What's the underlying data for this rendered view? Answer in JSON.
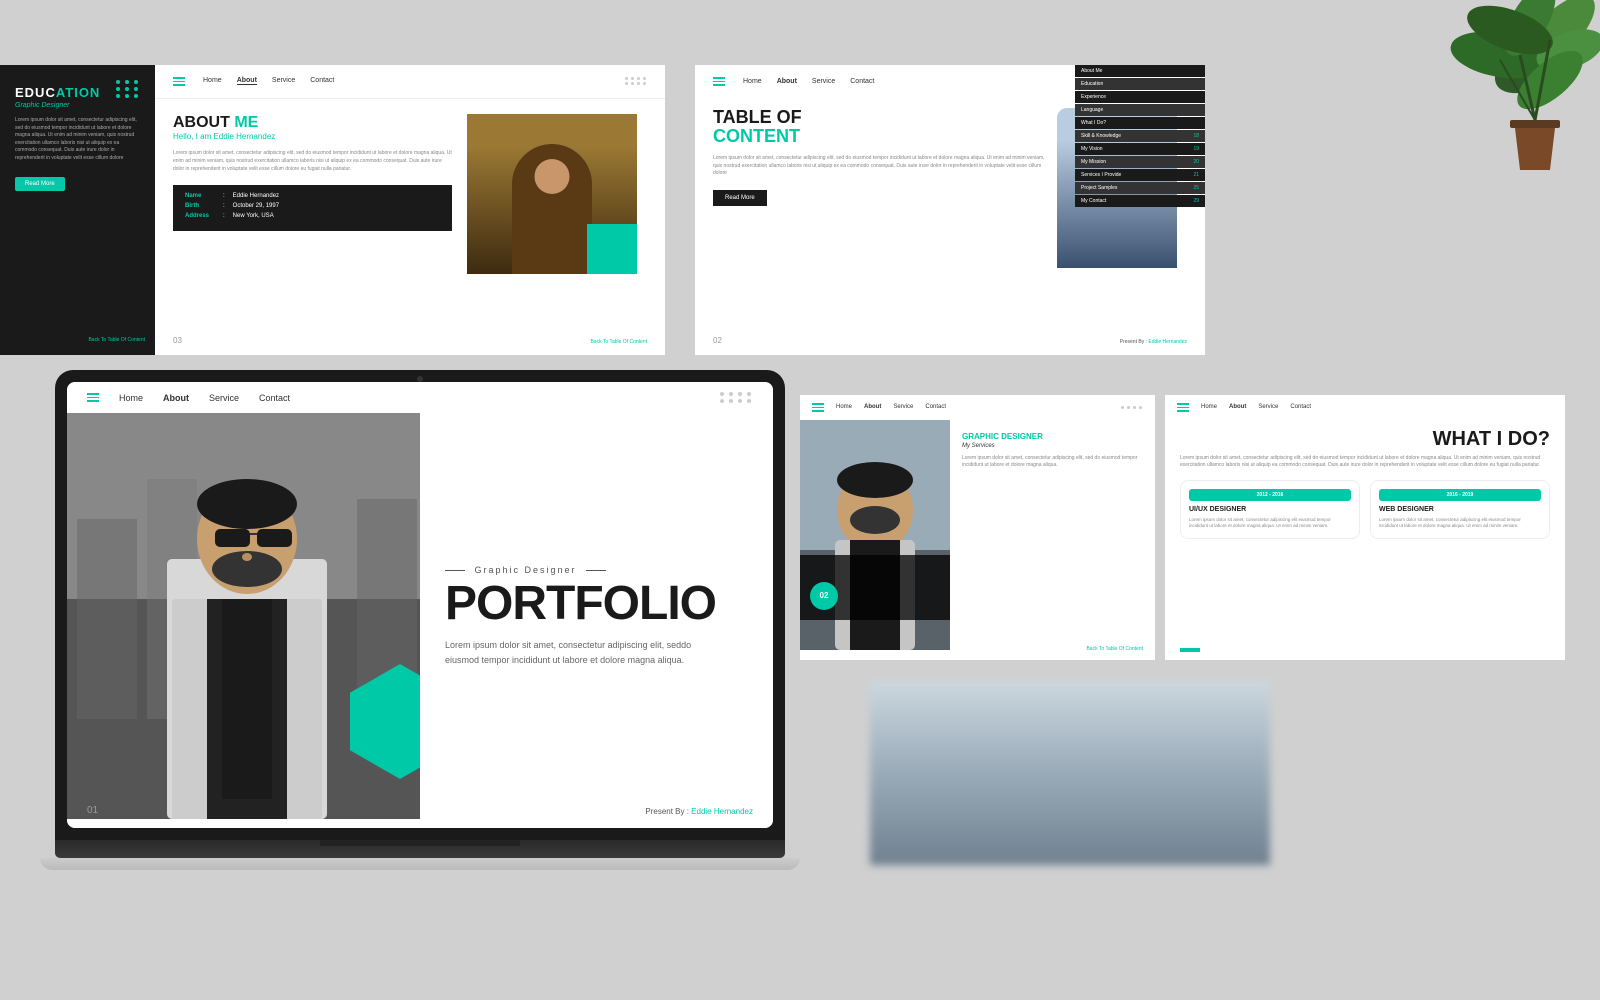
{
  "page": {
    "background": "#d0d0d0"
  },
  "slide_education": {
    "title_prefix": "EDUC",
    "title_suffix": "ATION",
    "subtitle": "Graphic Designer",
    "body": "Lorem ipsum dolor sit amet, consectetur adipiscing elit, sed do eiusmod tempor incididunt ut labore et dolore magna aliqua. Ut enim ad minim veniam, quis nostrud exercitation ullamco laboris nisi ut aliquip ex ea commodo consequat. Duis aute irure dolor in reprehenderit in voluptate velit esse cillum dolore",
    "read_more": "Read More",
    "back_link": "Back To Table Of Content"
  },
  "slide_about": {
    "nav": {
      "links": [
        "Home",
        "About",
        "Service",
        "Contact"
      ],
      "active": "About"
    },
    "title": "ABOUT ME",
    "greeting": "Hello, I am Eddie Hernandez",
    "lorem": "Lorem ipsum dolor sit amet, consectetur adipiscing elit, sed do eiusmod tempor incididunt ut labore et dolore magna aliqua. Ut enim ad minim veniam, quis nostrud exercitation ullamco laboris nisi ut aliquip ex ea commodo consequat. Duis aute irure dolor in reprehenderit in voluptate velit esse cillum dolore eu fugiat nulla pariatur.",
    "info": {
      "name_label": "Name",
      "name_value": "Eddie Hernandez",
      "birth_label": "Birth",
      "birth_value": "October 29, 1997",
      "address_label": "Address",
      "address_value": "New York, USA"
    },
    "page_num": "03",
    "back_link": "Back To Table Of Content"
  },
  "slide_toc": {
    "nav": {
      "links": [
        "Home",
        "About",
        "Service",
        "Contact"
      ],
      "active": "About"
    },
    "title_line1": "TABLE OF",
    "title_line2": "CONTENT",
    "lorem": "Lorem ipsum dolor sit amet, consectetur adipiscing elit, sed do eiusmod tempor incididunt ut labore et dolore magna aliqua. Ut enim ad minim veniam, quis nostrud exercitation ullamco laboris nisi ut aliquip ex ea commodo consequat. Duis aute irure dolor in reprehenderit in voluptate velit esse cillum dolore",
    "read_btn": "Read More",
    "toc_items": [
      {
        "label": "About Me",
        "num": ""
      },
      {
        "label": "Education",
        "num": ""
      },
      {
        "label": "Experience",
        "num": ""
      },
      {
        "label": "Language",
        "num": ""
      },
      {
        "label": "What I Do?",
        "num": ""
      },
      {
        "label": "Skill & Knowledge",
        "num": "18"
      },
      {
        "label": "My Vision",
        "num": "19"
      },
      {
        "label": "My Mission",
        "num": "20"
      },
      {
        "label": "Services I Provide",
        "num": "21"
      },
      {
        "label": "Project Samples",
        "num": "25"
      },
      {
        "label": "My Contact",
        "num": "29"
      }
    ],
    "page_num": "02",
    "presenter": "Present By : Eddie Hernandez"
  },
  "portfolio_slide": {
    "nav": {
      "links": [
        "Home",
        "About",
        "Service",
        "Contact"
      ],
      "active": "About"
    },
    "designer_label": "Graphic Designer",
    "title": "PORTFOLIO",
    "desc": "Lorem ipsum dolor sit amet, consectetur adipiscing elit, seddo eiusmod tempor incididunt ut labore et dolore magna aliqua.",
    "page_num": "01",
    "presenter": "Present By : Eddie Hernandez"
  },
  "slide_service": {
    "nav": {
      "links": [
        "Home",
        "About",
        "Service",
        "Contact"
      ],
      "active": "About"
    },
    "service_num": "02",
    "service_title": "GRAPHIC DESIGNER",
    "service_subtitle": "My Services",
    "service_desc": "Lorem ipsum dolor sit amet, consectetur adipiscing elit, sed do eiusmod tempor incididunt ut labore et dolore magna aliqua.",
    "back_link": "Back To Table Of Content"
  },
  "slide_whatido": {
    "nav": {
      "links": [
        "Home",
        "About",
        "Service",
        "Contact"
      ],
      "active": "About"
    },
    "title": "WHAT I DO?",
    "lorem": "Lorem ipsum dolor sit amet, consectetur adipiscing elit, sed do eiusmod tempor incididunt ut labore et dolore magna aliqua. Ut enim ad minim veniam, quis nostrud exercitation ullamco laboris nisi ut aliquip ea commodo consequat. Duis aute irure dolor in reprehenderit in voluptate velit esse cillum dolore eu fugiat nulla pariatur.",
    "cards": [
      {
        "date": "2012 - 2016",
        "role": "UI/UX DESIGNER",
        "desc": "Lorem ipsum dolor sit amet, consectetur adipiscing elit eiusmod tempor incididunt ut labore et dolore magna aliqua. Ut enim ad minim veniam."
      },
      {
        "date": "2016 - 2019",
        "role": "WEB DESIGNER",
        "desc": "Lorem ipsum dolor sit amet, consectetur adipiscing elit eiusmod tempor incididunt ut labore et dolore magna aliqua. Ut enim ad minim veniam."
      }
    ]
  }
}
